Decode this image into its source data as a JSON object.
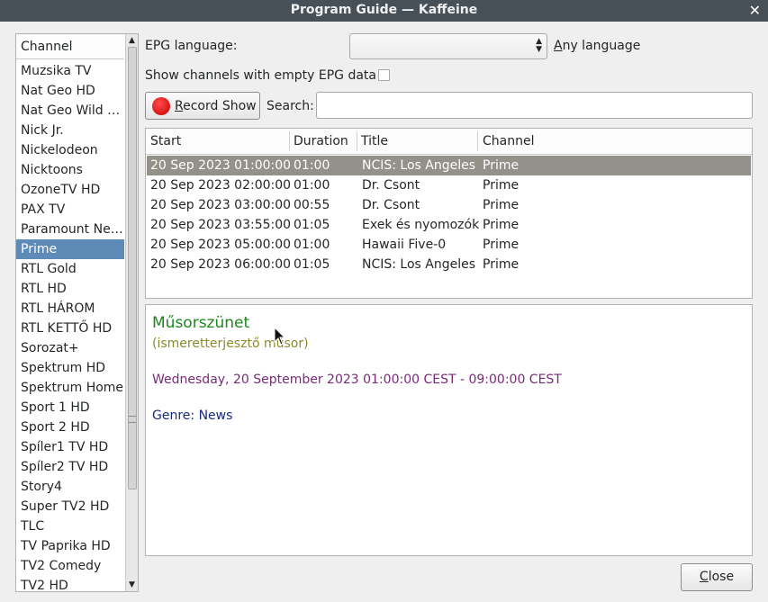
{
  "window": {
    "title": "Program Guide — Kaffeine",
    "close_glyph": "✕"
  },
  "channels": {
    "header": "Channel",
    "items": [
      {
        "label": "Muzsika TV"
      },
      {
        "label": "Nat Geo HD"
      },
      {
        "label": "Nat Geo Wild HD"
      },
      {
        "label": "Nick Jr."
      },
      {
        "label": "Nickelodeon"
      },
      {
        "label": "Nicktoons"
      },
      {
        "label": "OzoneTV HD"
      },
      {
        "label": "PAX TV"
      },
      {
        "label": "Paramount Network"
      },
      {
        "label": "Prime",
        "selected": true
      },
      {
        "label": "RTL Gold"
      },
      {
        "label": "RTL HD"
      },
      {
        "label": "RTL HÁROM"
      },
      {
        "label": "RTL KETTŐ HD"
      },
      {
        "label": "Sorozat+"
      },
      {
        "label": "Spektrum HD"
      },
      {
        "label": "Spektrum Home"
      },
      {
        "label": "Sport 1 HD"
      },
      {
        "label": "Sport 2 HD"
      },
      {
        "label": "Spíler1 TV HD"
      },
      {
        "label": "Spíler2 TV HD"
      },
      {
        "label": "Story4"
      },
      {
        "label": "Super TV2 HD"
      },
      {
        "label": "TLC"
      },
      {
        "label": "TV Paprika HD"
      },
      {
        "label": "TV2 Comedy"
      },
      {
        "label": "TV2 HD"
      }
    ]
  },
  "controls": {
    "epg_language_label": "EPG language:",
    "epg_language_value": "",
    "any_language": "Any language",
    "show_empty_label": "Show channels with empty EPG data",
    "show_empty_checked": false,
    "record_show": "Record Show",
    "search_label": "Search:",
    "search_value": ""
  },
  "table": {
    "columns": [
      "Start",
      "Duration",
      "Title",
      "Channel"
    ],
    "rows": [
      {
        "start": "20 Sep 2023 01:00:00",
        "duration": "01:00",
        "title": "NCIS: Los Angeles",
        "channel": "Prime",
        "selected": true
      },
      {
        "start": "20 Sep 2023 02:00:00",
        "duration": "01:00",
        "title": "Dr. Csont",
        "channel": "Prime"
      },
      {
        "start": "20 Sep 2023 03:00:00",
        "duration": "00:55",
        "title": "Dr. Csont",
        "channel": "Prime"
      },
      {
        "start": "20 Sep 2023 03:55:00",
        "duration": "01:05",
        "title": "Exek és nyomozók",
        "channel": "Prime"
      },
      {
        "start": "20 Sep 2023 05:00:00",
        "duration": "01:00",
        "title": "Hawaii Five-0",
        "channel": "Prime"
      },
      {
        "start": "20 Sep 2023 06:00:00",
        "duration": "01:05",
        "title": "NCIS: Los Angeles",
        "channel": "Prime"
      }
    ]
  },
  "details": {
    "title": "Műsorszünet",
    "subtitle": "(ismeretterjesztő műsor)",
    "time": "Wednesday, 20 September 2023 01:00:00 CEST - 09:00:00 CEST",
    "genre": "Genre: News"
  },
  "footer": {
    "close": "Close"
  },
  "colors": {
    "titlebar": "#475057",
    "channel_selected": "#5e8ab8",
    "row_selected": "#93918a",
    "detail_title": "#1a8a1a",
    "detail_sub": "#8a8a2a",
    "detail_time": "#7a2a7a",
    "detail_genre": "#1a2a7a",
    "record_dot": "#d00000"
  }
}
